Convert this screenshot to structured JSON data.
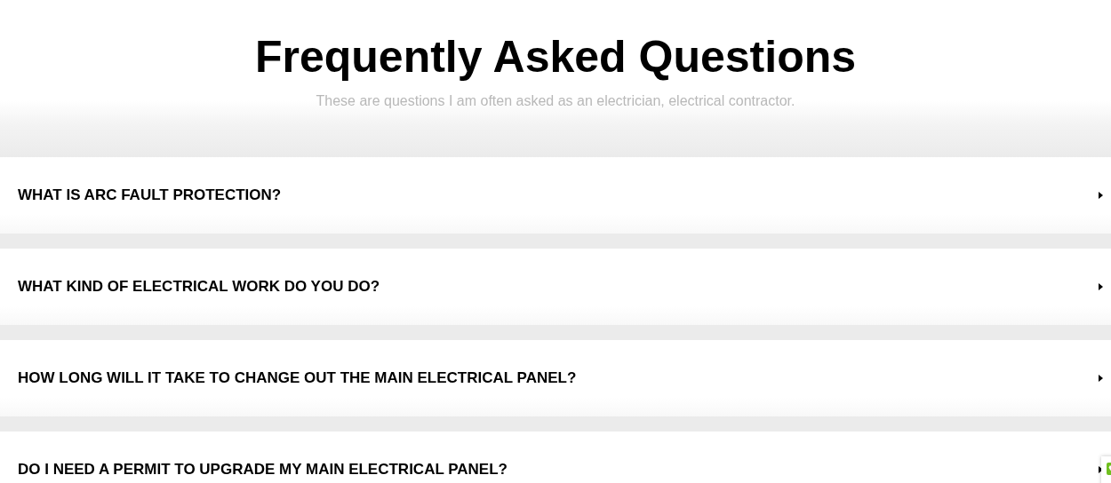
{
  "header": {
    "title": "Frequently Asked Questions",
    "subtitle": "These are questions I am often asked as an electrician, electrical contractor."
  },
  "faq": [
    {
      "question": "WHAT IS ARC FAULT PROTECTION?",
      "expanded": false
    },
    {
      "question": "WHAT KIND OF ELECTRICAL WORK DO YOU DO?",
      "expanded": false
    },
    {
      "question": "HOW LONG WILL IT TAKE TO CHANGE OUT THE MAIN ELECTRICAL PANEL?",
      "expanded": false
    },
    {
      "question": "DO I NEED A PERMIT TO UPGRADE MY MAIN ELECTRICAL PANEL?",
      "expanded": false
    }
  ]
}
